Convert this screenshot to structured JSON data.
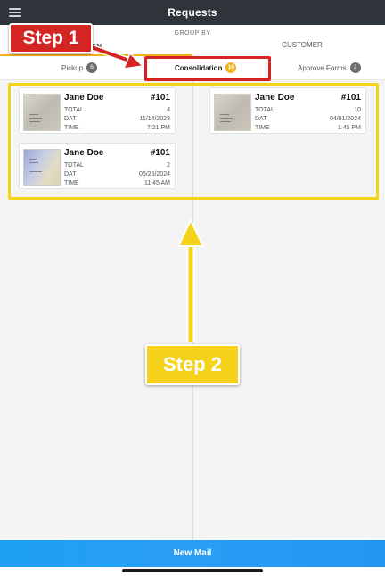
{
  "header": {
    "title": "Requests"
  },
  "groupby": {
    "label": "GROUP BY",
    "left_option": "ON",
    "right_option": "CUSTOMER"
  },
  "tabs": [
    {
      "label": "Pickup",
      "count": "6"
    },
    {
      "label": "Consolidation",
      "count": "16"
    },
    {
      "label": "Approve Forms",
      "count": "2"
    }
  ],
  "cards": [
    {
      "name": "Jane Doe",
      "number": "#101",
      "total_label": "TOTAL",
      "total": "4",
      "date_label": "DAT",
      "date": "11/14/2023",
      "time_label": "TIME",
      "time": "7:21 PM"
    },
    {
      "name": "Jane Doe",
      "number": "#101",
      "total_label": "TOTAL",
      "total": "2",
      "date_label": "DAT",
      "date": "06/25/2024",
      "time_label": "TIME",
      "time": "11:45 AM"
    },
    {
      "name": "Jane Doe",
      "number": "#101",
      "total_label": "TOTAL",
      "total": "10",
      "date_label": "DAT",
      "date": "04/01/2024",
      "time_label": "TIME",
      "time": "1:45 PM"
    }
  ],
  "footer": {
    "new_mail_label": "New Mail"
  },
  "annotations": {
    "step1": "Step 1",
    "step2": "Step 2"
  },
  "colors": {
    "accent": "#f2b21e",
    "step1": "#d42424",
    "step2": "#f6d21a",
    "button": "#1da1f2",
    "header": "#2f343a"
  },
  "icons": {
    "menu": "hamburger-menu-icon"
  }
}
